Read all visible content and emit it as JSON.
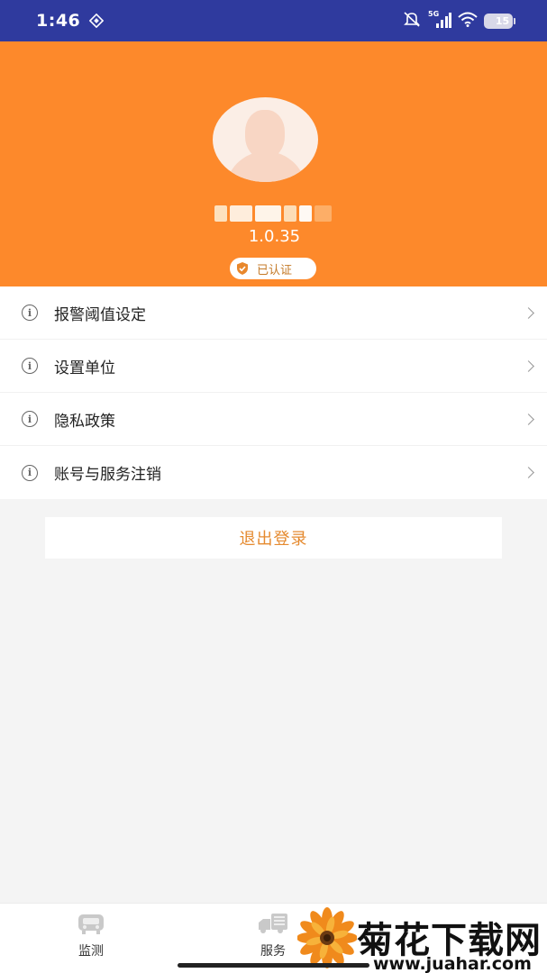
{
  "status_bar": {
    "time": "1:46",
    "network": "5G",
    "battery_level": "15"
  },
  "profile": {
    "version": "1.0.35",
    "verified_label": "已认证"
  },
  "menu": {
    "items": [
      {
        "label": "报警阈值设定",
        "icon": "info-icon"
      },
      {
        "label": "设置单位",
        "icon": "info-icon"
      },
      {
        "label": "隐私政策",
        "icon": "info-icon"
      },
      {
        "label": "账号与服务注销",
        "icon": "info-icon"
      }
    ]
  },
  "logout_label": "退出登录",
  "tabbar": {
    "tabs": [
      {
        "label": "监测",
        "icon": "car-monitor-icon"
      },
      {
        "label": "服务",
        "icon": "truck-service-icon"
      }
    ]
  },
  "watermark": {
    "title": "菊花下载网",
    "url": "www.juahar.com"
  },
  "colors": {
    "status_bar": "#2f3a9e",
    "header": "#fd892b",
    "accent_text": "#e58a2f"
  }
}
